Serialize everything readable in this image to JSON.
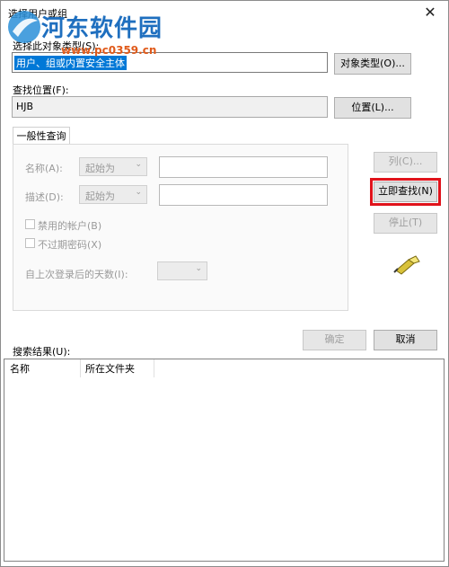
{
  "window": {
    "title": "选择用户或组",
    "close_glyph": "✕"
  },
  "watermark": {
    "name": "河东软件园",
    "url": "www.pc0359.cn"
  },
  "object_type": {
    "label": "选择此对象类型(S):",
    "value": "用户、组或内置安全主体",
    "button": "对象类型(O)..."
  },
  "location": {
    "label": "查找位置(F):",
    "value": "HJB",
    "button": "位置(L)..."
  },
  "query": {
    "tab": "一般性查询",
    "name_label": "名称(A):",
    "name_mode": "起始为",
    "desc_label": "描述(D):",
    "desc_mode": "起始为",
    "disabled_accounts": "禁用的帐户(B)",
    "no_expire_pwd": "不过期密码(X)",
    "days_label": "自上次登录后的天数(I):",
    "columns_button": "列(C)...",
    "find_now_button": "立即查找(N)",
    "stop_button": "停止(T)"
  },
  "actions": {
    "ok": "确定",
    "cancel": "取消"
  },
  "results": {
    "label": "搜索结果(U):",
    "columns": [
      "名称",
      "所在文件夹"
    ]
  },
  "colors": {
    "highlight": "#e0131b",
    "selection": "#0078d7"
  }
}
